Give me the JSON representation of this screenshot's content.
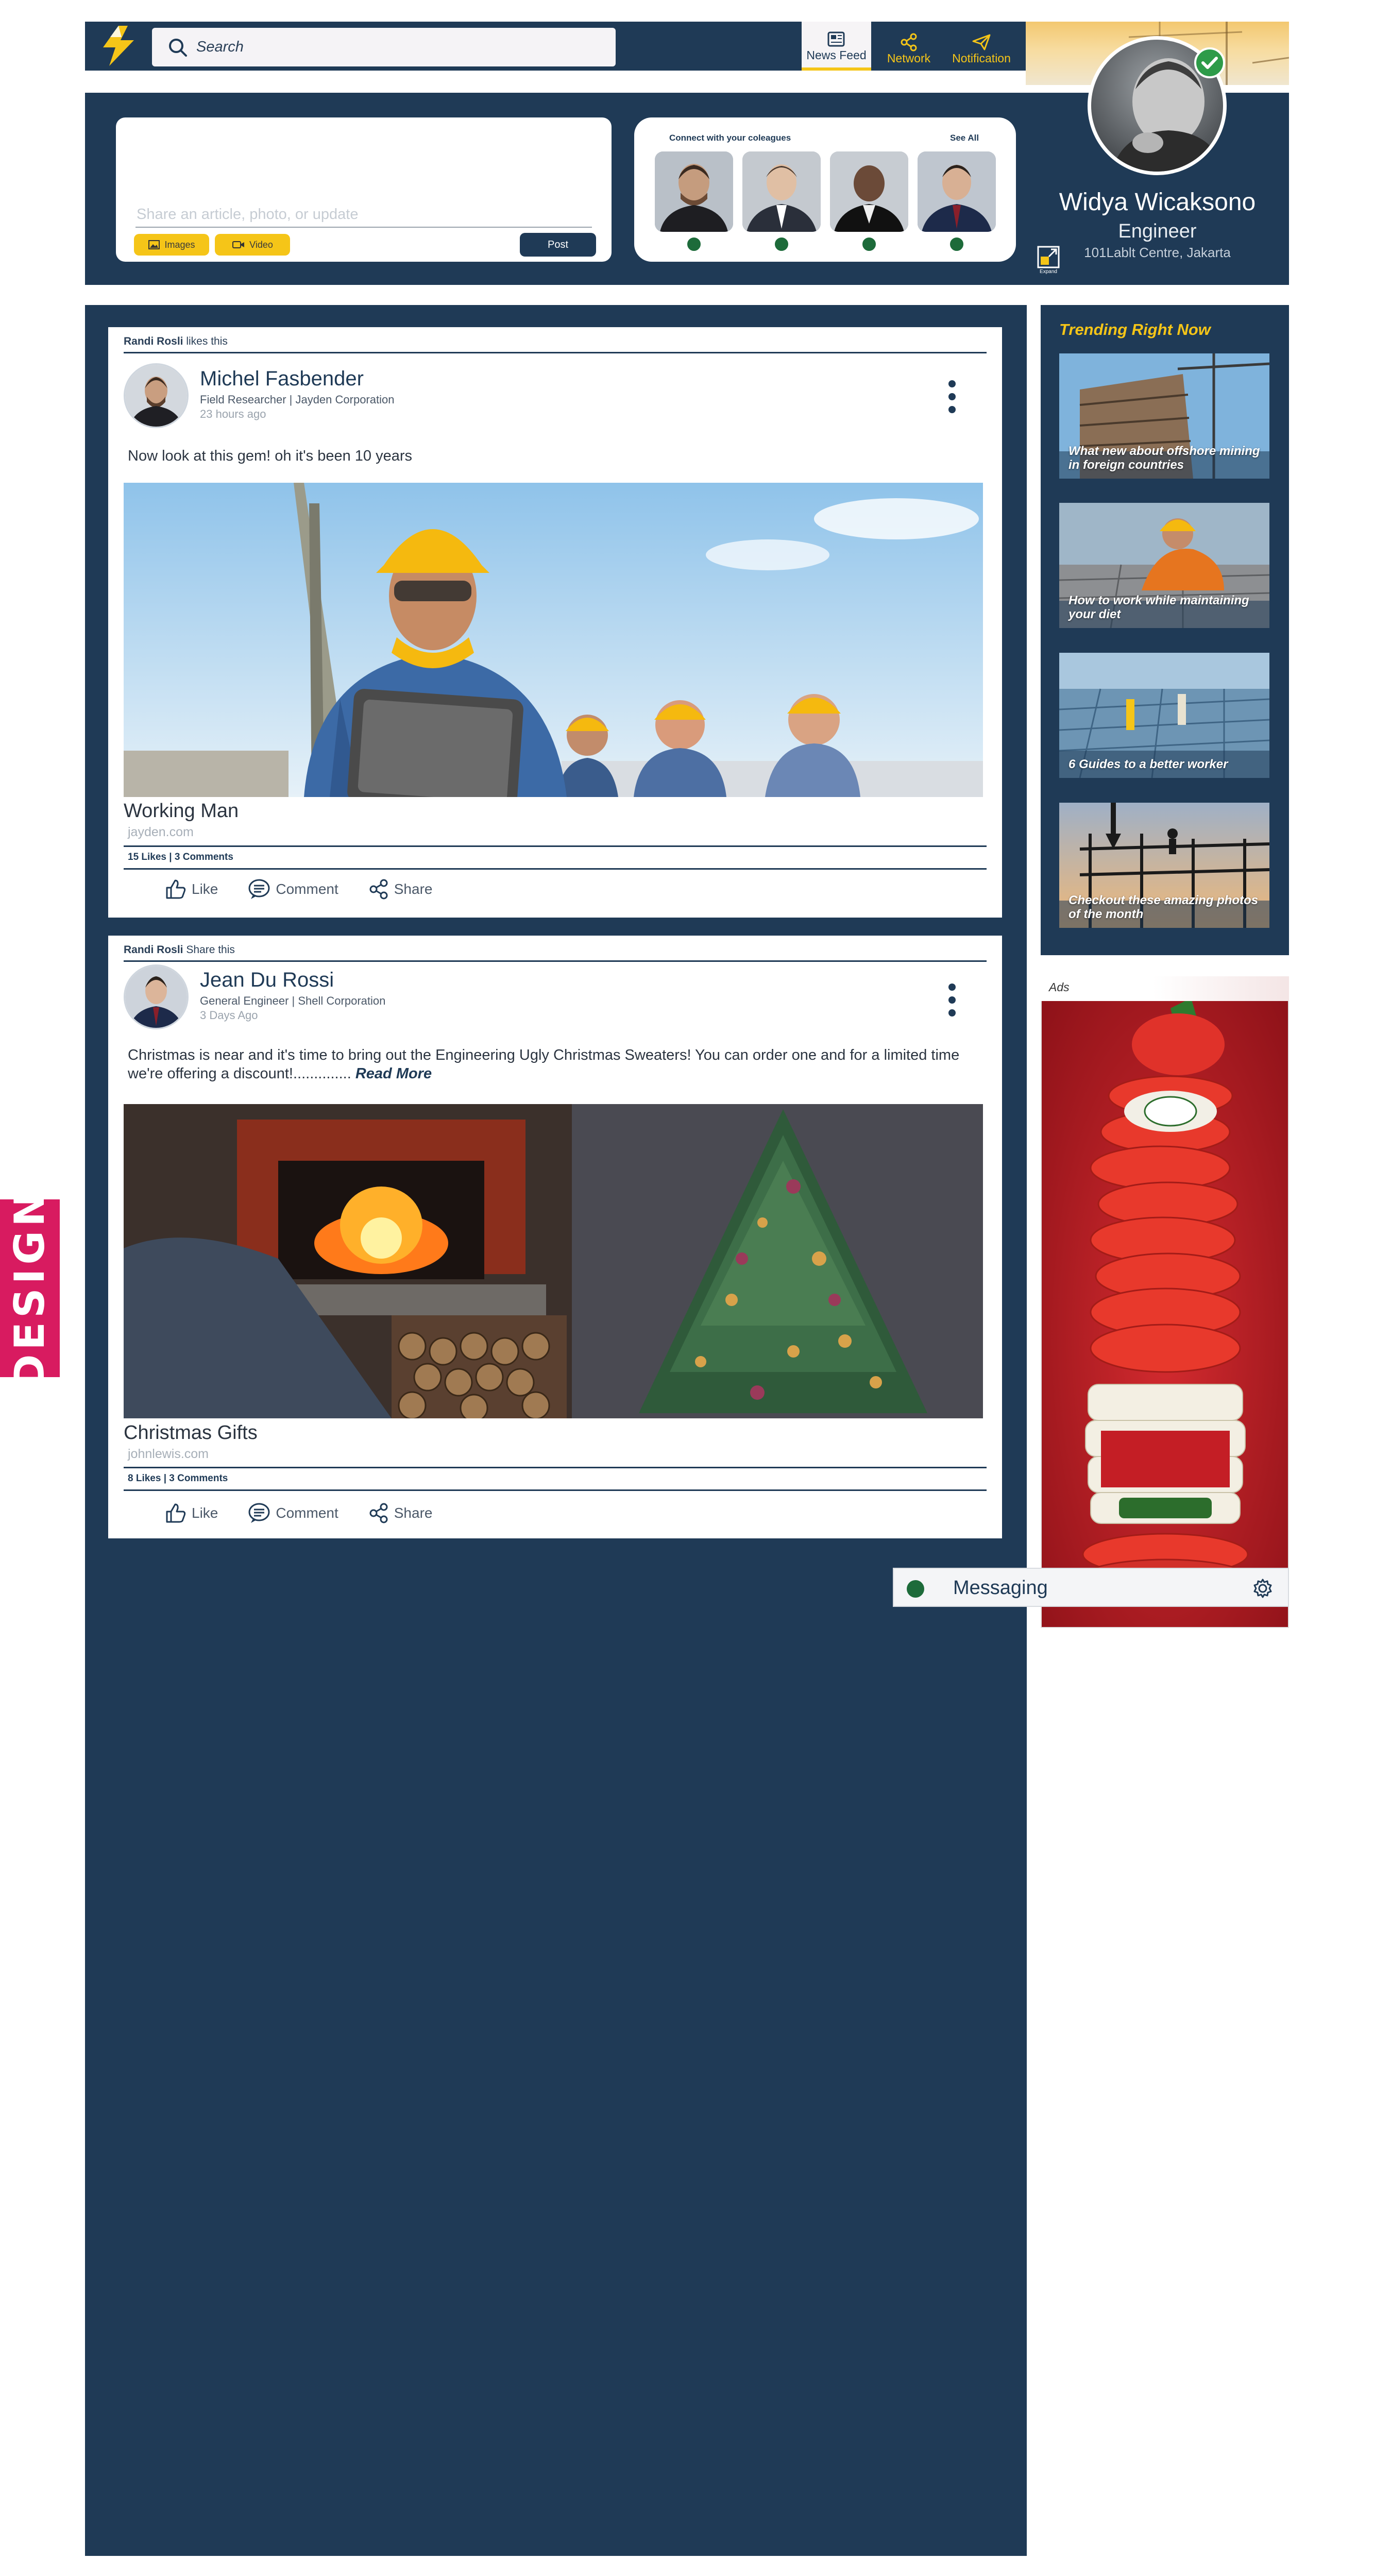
{
  "header": {
    "search_placeholder": "Search",
    "nav": [
      {
        "label": "News Feed",
        "icon": "newspaper-icon",
        "active": true
      },
      {
        "label": "Network",
        "icon": "network-icon",
        "active": false
      },
      {
        "label": "Notification",
        "icon": "paper-plane-icon",
        "active": false
      }
    ]
  },
  "composer": {
    "placeholder": "Share an article, photo, or update",
    "images_label": "Images",
    "video_label": "Video",
    "post_label": "Post"
  },
  "colleagues": {
    "heading": "Connect with your coleagues",
    "see_all": "See All"
  },
  "profile": {
    "name": "Widya Wicaksono",
    "title": "Engineer",
    "location": "101Lablt Centre, Jakarta",
    "expand_label": "Expand"
  },
  "posts": [
    {
      "activity_user": "Randi Rosli",
      "activity_text": " likes this",
      "author": "Michel Fasbender",
      "role": "Field Researcher | Jayden Corporation",
      "time": "23 hours ago",
      "body": "Now look at this gem! oh it's been 10 years",
      "title": "Working Man",
      "domain": "jayden.com",
      "stats": "15 Likes | 3 Comments"
    },
    {
      "activity_user": "Randi Rosli",
      "activity_text": " Share this",
      "author": "Jean Du Rossi",
      "role": "General Engineer | Shell Corporation",
      "time": "3 Days Ago",
      "body": "Christmas is near and it's time to bring out the Engineering Ugly Christmas Sweaters! You can order one and for a limited time we're offering a discount!..............",
      "read_more": "Read More",
      "title": "Christmas Gifts",
      "domain": "johnlewis.com",
      "stats": "8 Likes | 3 Comments"
    }
  ],
  "post_actions": {
    "like": "Like",
    "comment": "Comment",
    "share": "Share"
  },
  "trending": {
    "heading": "Trending Right Now",
    "items": [
      "What new about offshore mining in foreign countries",
      "How to work while maintaining your diet",
      "6 Guides to a better worker",
      "Checkout these amazing photos of the month"
    ]
  },
  "ads": {
    "label": "Ads"
  },
  "messaging": {
    "label": "Messaging"
  },
  "badge": {
    "label": "DESIGN"
  },
  "colors": {
    "navy": "#1f3a56",
    "yellow": "#f5c518",
    "green": "#1d6b3a",
    "pink": "#d81b60"
  }
}
